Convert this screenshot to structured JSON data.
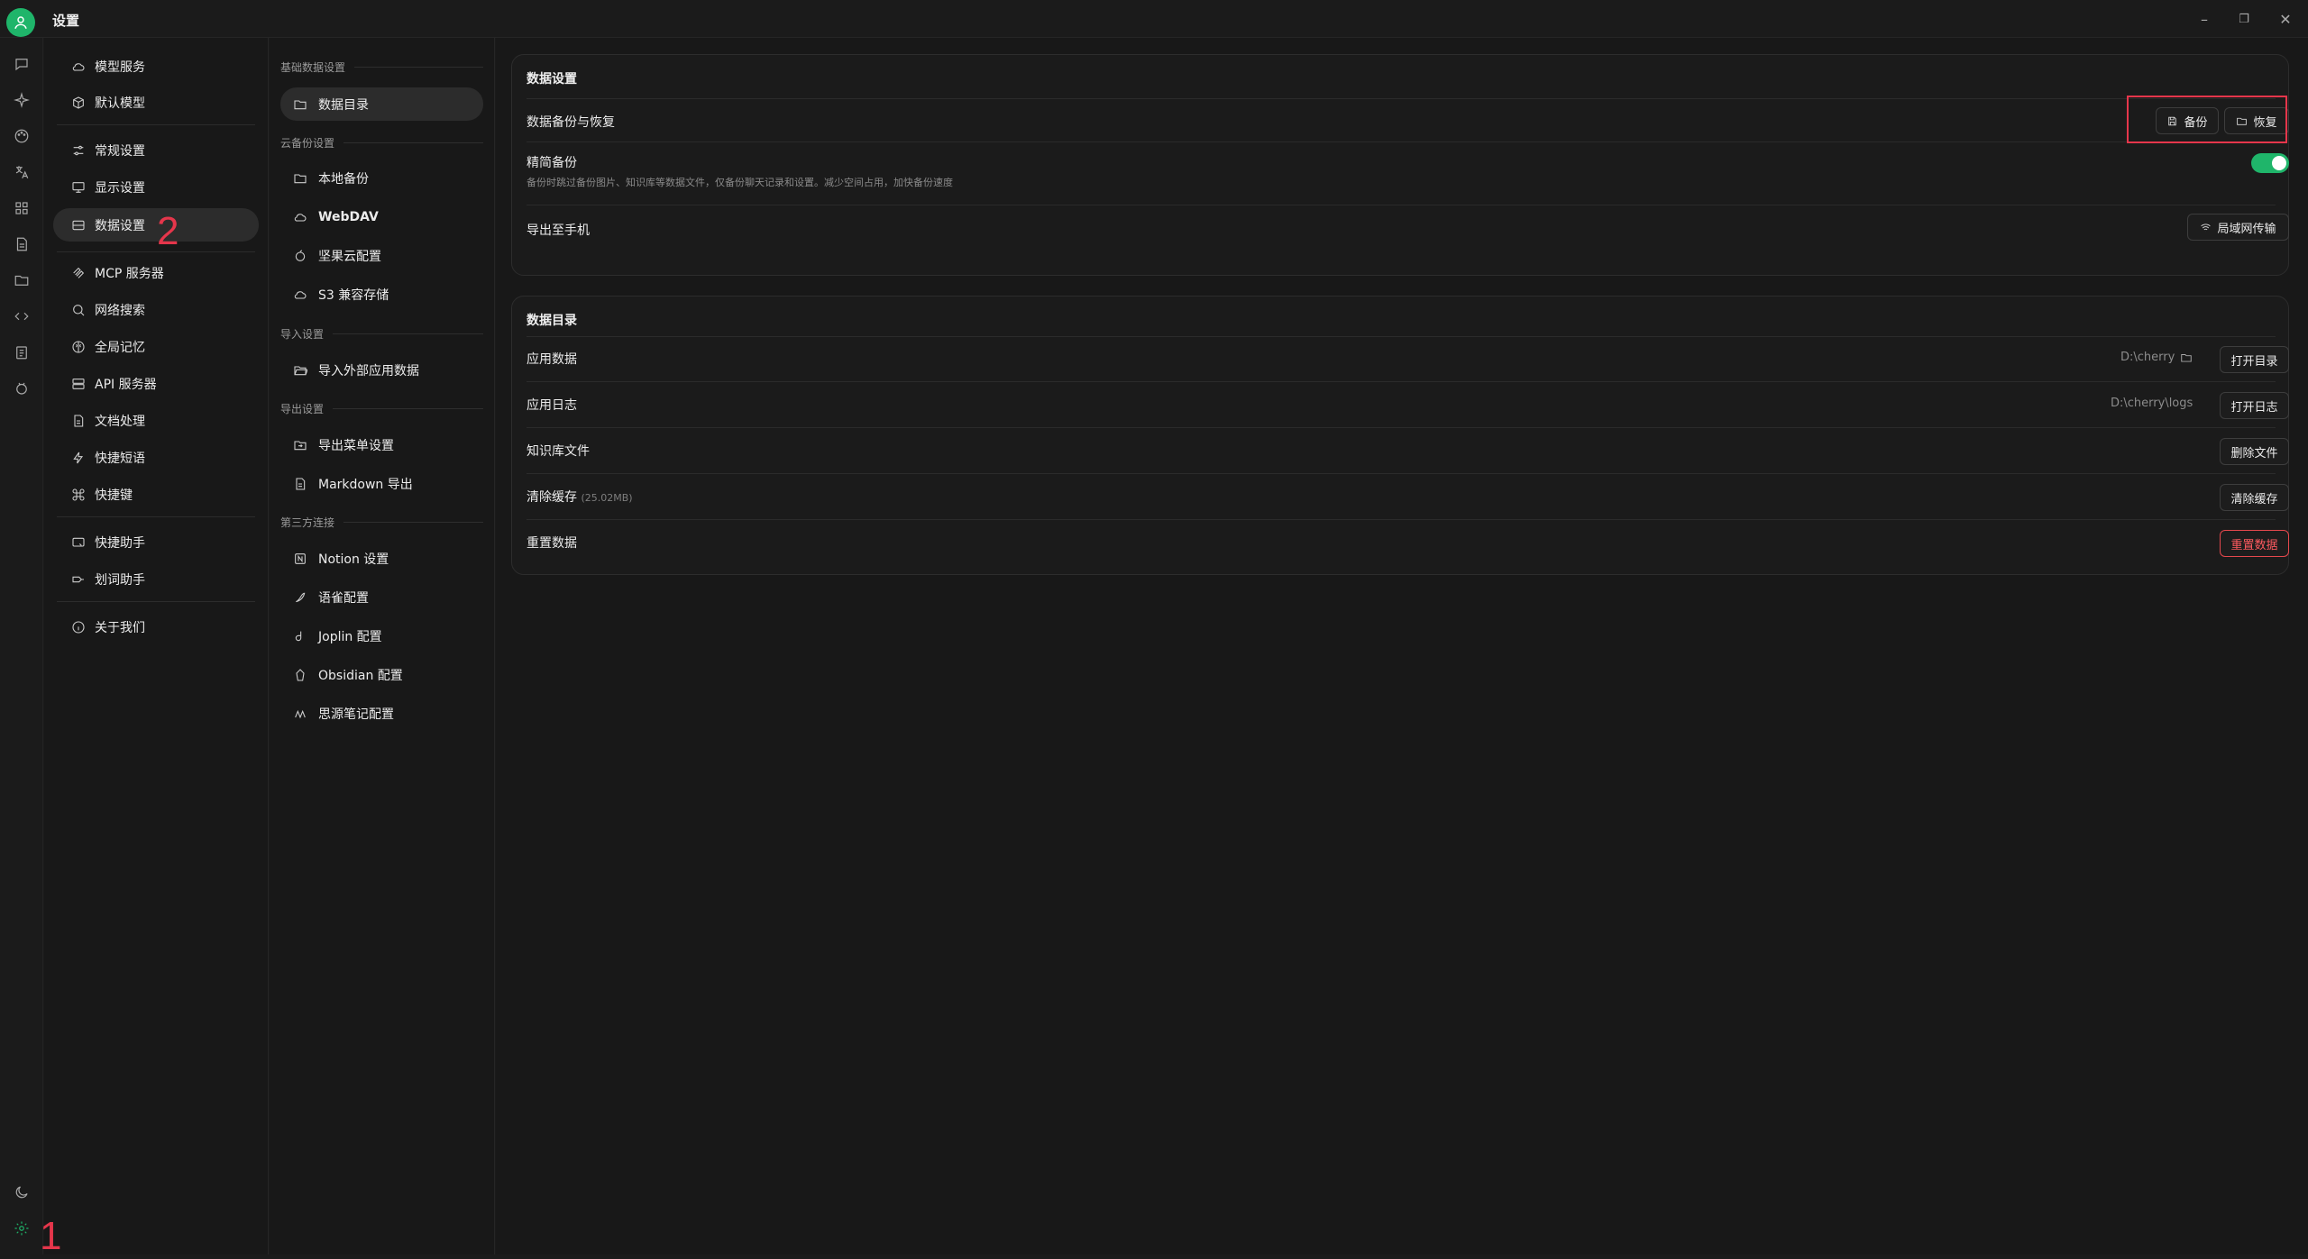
{
  "window": {
    "title": "设置",
    "controls": [
      "–",
      "❐",
      "✕"
    ]
  },
  "iconbar": {
    "top_icons": [
      "chat-icon",
      "sparkle-icon",
      "palette-icon",
      "translate-icon",
      "apps-icon",
      "files-icon",
      "folder-icon",
      "code-icon",
      "clipboard-icon",
      "bot-icon"
    ],
    "bottom_icons": [
      "moon-icon",
      "settings-icon"
    ]
  },
  "nav1": {
    "items": [
      {
        "label": "模型服务",
        "icon": "cloud-icon"
      },
      {
        "label": "默认模型",
        "icon": "cube-icon"
      },
      {
        "label": "常规设置",
        "icon": "sliders-icon"
      },
      {
        "label": "显示设置",
        "icon": "monitor-icon"
      },
      {
        "label": "数据设置",
        "icon": "database-icon"
      },
      {
        "label": "MCP 服务器",
        "icon": "mcp-icon"
      },
      {
        "label": "网络搜索",
        "icon": "search-icon"
      },
      {
        "label": "全局记忆",
        "icon": "brain-icon"
      },
      {
        "label": "API 服务器",
        "icon": "server-icon"
      },
      {
        "label": "文档处理",
        "icon": "document-icon"
      },
      {
        "label": "快捷短语",
        "icon": "zap-icon"
      },
      {
        "label": "快捷键",
        "icon": "command-icon"
      },
      {
        "label": "快捷助手",
        "icon": "assistant-icon"
      },
      {
        "label": "划词助手",
        "icon": "select-text-icon"
      },
      {
        "label": "关于我们",
        "icon": "info-icon"
      }
    ],
    "active_index": 4
  },
  "nav2": {
    "sections": [
      {
        "title": "基础数据设置",
        "items": [
          {
            "label": "数据目录",
            "icon": "folder-icon"
          }
        ]
      },
      {
        "title": "云备份设置",
        "items": [
          {
            "label": "本地备份",
            "icon": "folder-icon"
          },
          {
            "label": "WebDAV",
            "icon": "cloud-icon"
          },
          {
            "label": "坚果云配置",
            "icon": "nut-icon"
          },
          {
            "label": "S3 兼容存储",
            "icon": "cloud-icon"
          }
        ]
      },
      {
        "title": "导入设置",
        "items": [
          {
            "label": "导入外部应用数据",
            "icon": "folder-open-icon"
          }
        ]
      },
      {
        "title": "导出设置",
        "items": [
          {
            "label": "导出菜单设置",
            "icon": "export-icon"
          },
          {
            "label": "Markdown 导出",
            "icon": "file-text-icon"
          }
        ]
      },
      {
        "title": "第三方连接",
        "items": [
          {
            "label": "Notion 设置",
            "icon": "notion-icon"
          },
          {
            "label": "语雀配置",
            "icon": "yuque-icon"
          },
          {
            "label": "Joplin 配置",
            "icon": "joplin-icon"
          },
          {
            "label": "Obsidian 配置",
            "icon": "obsidian-icon"
          },
          {
            "label": "思源笔记配置",
            "icon": "siyuan-icon"
          }
        ]
      }
    ]
  },
  "data_settings": {
    "title": "数据设置",
    "backup_row": {
      "label": "数据备份与恢复",
      "backup_btn": "备份",
      "restore_btn": "恢复"
    },
    "lite_backup": {
      "label": "精简备份",
      "desc": "备份时跳过备份图片、知识库等数据文件，仅备份聊天记录和设置。减少空间占用，加快备份速度",
      "enabled": true
    },
    "export_phone": {
      "label": "导出至手机",
      "btn": "局域网传输"
    }
  },
  "data_dir": {
    "title": "数据目录",
    "app_data": {
      "label": "应用数据",
      "path": "D:\\cherry",
      "btn": "打开目录"
    },
    "app_log": {
      "label": "应用日志",
      "path": "D:\\cherry\\logs",
      "btn": "打开日志"
    },
    "kb_files": {
      "label": "知识库文件",
      "btn": "删除文件"
    },
    "clear_cache": {
      "label": "清除缓存",
      "size": "(25.02MB)",
      "btn": "清除缓存"
    },
    "reset": {
      "label": "重置数据",
      "btn": "重置数据"
    }
  },
  "annotations": {
    "one": "1",
    "two": "2"
  },
  "colors": {
    "accent": "#1fb56a",
    "danger": "#e5484d",
    "annotation": "#e5364b"
  }
}
